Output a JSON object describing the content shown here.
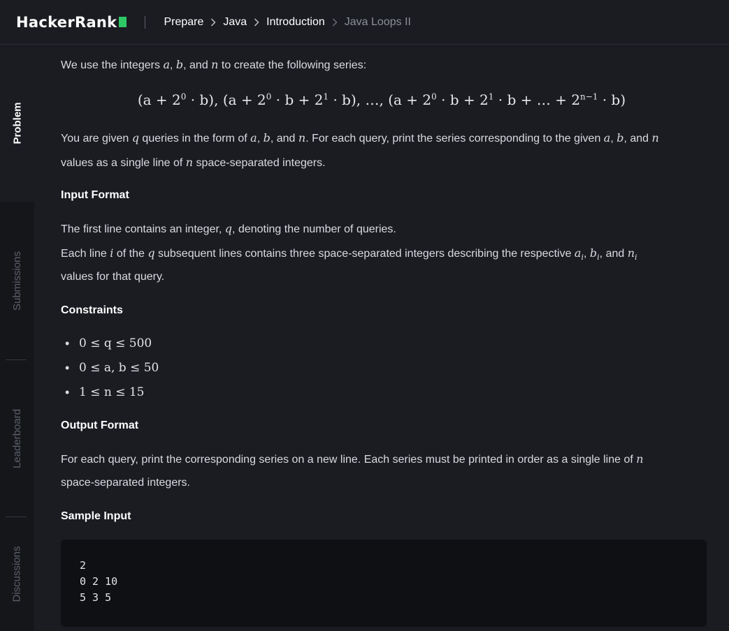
{
  "header": {
    "logo_text": "HackerRank",
    "breadcrumbs": [
      "Prepare",
      "Java",
      "Introduction",
      "Java Loops II"
    ]
  },
  "sidetabs": [
    "Problem",
    "Submissions",
    "Leaderboard",
    "Discussions"
  ],
  "problem": {
    "intro": {
      "t1": "We use the integers ",
      "a": "a",
      "t2": ", ",
      "b": "b",
      "t3": ", and ",
      "n": "n",
      "t4": " to create the following series:"
    },
    "formula": {
      "f1": "(a + 2",
      "e1": "0",
      "f2": " · b), (a + 2",
      "e2": "0",
      "f3": " · b + 2",
      "e3": "1",
      "f4": " · b), …, (a + 2",
      "e4": "0",
      "f5": " · b + 2",
      "e5": "1",
      "f6": " · b + … + 2",
      "e6": "n−1",
      "f7": " · b)"
    },
    "desc1": {
      "t1": "You are given ",
      "q": "q",
      "t2": " queries in the form of ",
      "a": "a",
      "t3": ", ",
      "b": "b",
      "t4": ", and ",
      "n": "n",
      "t5": ". For each query, print the series corresponding to the given ",
      "a2": "a",
      "t6": ", ",
      "b2": "b",
      "t7": ", and ",
      "n2": "n"
    },
    "desc2": {
      "t1": "values as a single line of ",
      "n": "n",
      "t2": " space-separated integers."
    },
    "input_heading": "Input Format",
    "input1": {
      "t1": "The first line contains an integer, ",
      "q": "q",
      "t2": ", denoting the number of queries."
    },
    "input2": {
      "t1": "Each line ",
      "i": "i",
      "t2": " of the ",
      "q": "q",
      "t3": " subsequent lines contains three space-separated integers describing the respective ",
      "ai": "a",
      "ai_sub": "i",
      "t4": ", ",
      "bi": "b",
      "bi_sub": "i",
      "t5": ", and ",
      "ni": "n",
      "ni_sub": "i"
    },
    "input3": "values for that query.",
    "constraints_heading": "Constraints",
    "constraints": [
      "0 ≤ q ≤ 500",
      "0 ≤ a, b ≤ 50",
      "1 ≤ n ≤ 15"
    ],
    "output_heading": "Output Format",
    "output1": {
      "t1": "For each query, print the corresponding series on a new line. Each series must be printed in order as a single line of ",
      "n": "n"
    },
    "output2": "space-separated integers.",
    "sample_heading": "Sample Input",
    "sample_input": [
      "2",
      "0 2 10",
      "5 3 5"
    ]
  }
}
